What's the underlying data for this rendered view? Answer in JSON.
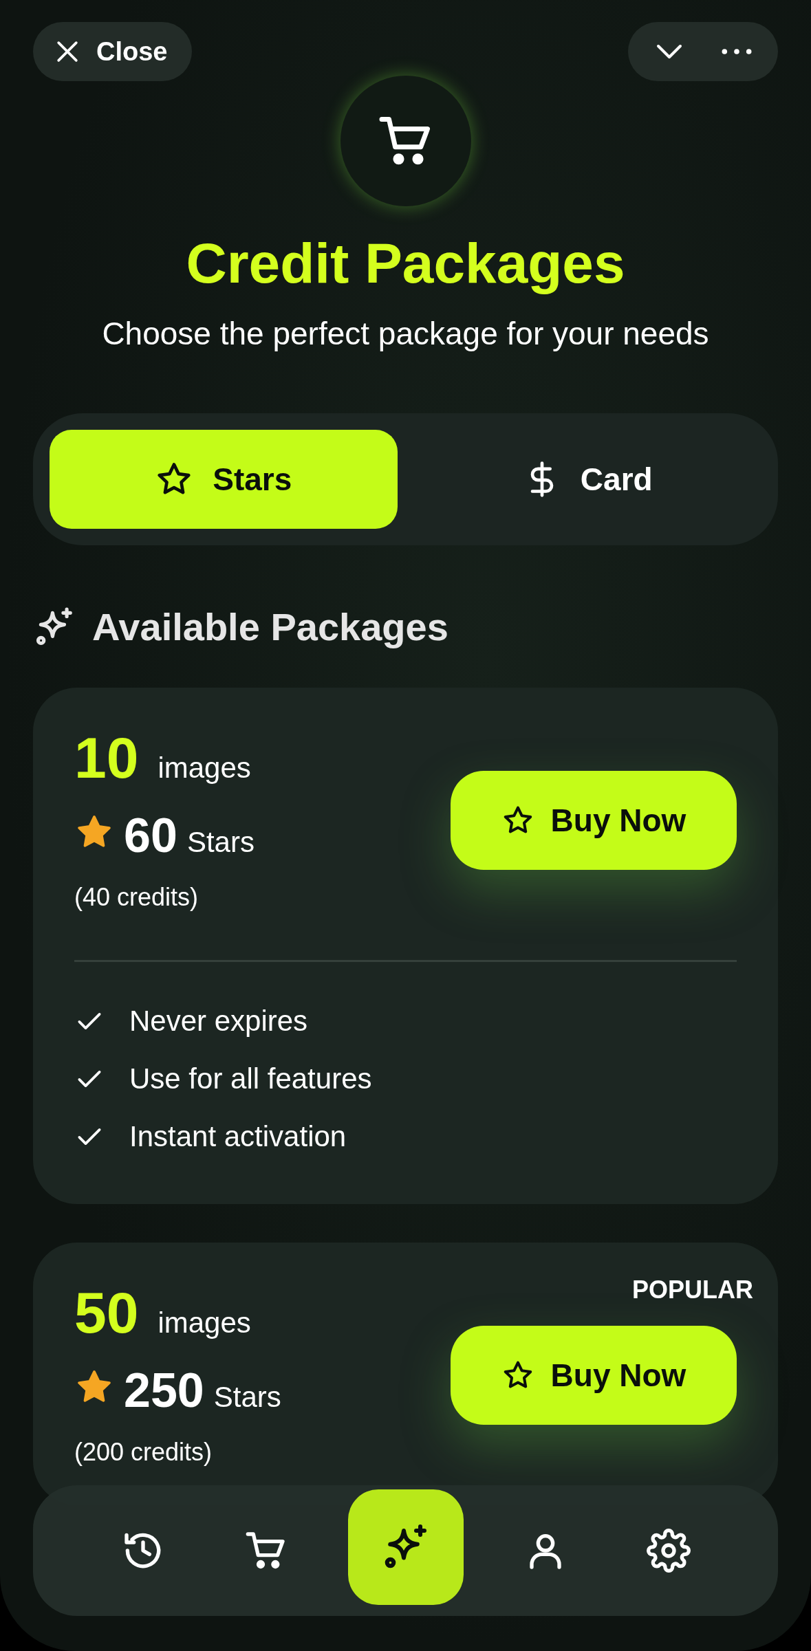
{
  "header": {
    "close_label": "Close"
  },
  "title": "Credit Packages",
  "subtitle": "Choose the perfect package for your needs",
  "tabs": [
    {
      "label": "Stars",
      "kind": "star",
      "selected": true
    },
    {
      "label": "Card",
      "kind": "dollar",
      "selected": false
    }
  ],
  "section_title": "Available Packages",
  "packages": [
    {
      "images": "10",
      "images_label": "images",
      "stars": "60",
      "stars_label": "Stars",
      "credits": "(40 credits)",
      "button": "Buy Now",
      "features": [
        "Never expires",
        "Use for all features",
        "Instant activation"
      ]
    },
    {
      "badge": "POPULAR",
      "images": "50",
      "images_label": "images",
      "stars": "250",
      "stars_label": "Stars",
      "credits": "(200 credits)",
      "button": "Buy Now"
    }
  ],
  "nav": [
    {
      "kind": "history",
      "selected": false
    },
    {
      "kind": "cart",
      "selected": false
    },
    {
      "kind": "sparkle",
      "selected": true
    },
    {
      "kind": "user",
      "selected": false
    },
    {
      "kind": "settings",
      "selected": false
    }
  ]
}
